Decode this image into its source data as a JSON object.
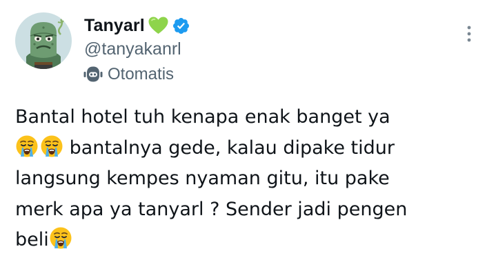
{
  "author": {
    "display_name": "Tanyarl",
    "name_emoji": "green-heart-icon",
    "verified_badge": "verified-badge-icon",
    "handle": "@tanyakanrl",
    "automated_label": "Otomatis",
    "automated_icon": "bot-icon",
    "avatar": "avatar"
  },
  "menu": {
    "icon": "more-options-icon"
  },
  "tweet": {
    "line_1": "Bantal hotel tuh kenapa enak banget ya",
    "line_2": "bantalnya gede, kalau dipake tidur",
    "line_3": "langsung kempes nyaman gitu, itu pake",
    "line_4": "merk apa ya tanyarl ? Sender jadi pengen",
    "line_5": "beli",
    "emoji": "loudly-crying-face-icon"
  },
  "colors": {
    "text": "#0f1419",
    "secondary_text": "#536471",
    "verified_blue": "#1d9bf0",
    "heart_green": "#8ed44b",
    "avatar_bg": "#ccdfe3",
    "avatar_figure": "#5d8a63",
    "emoji_yellow": "#fcc21b",
    "emoji_tears": "#4fb0e8"
  }
}
